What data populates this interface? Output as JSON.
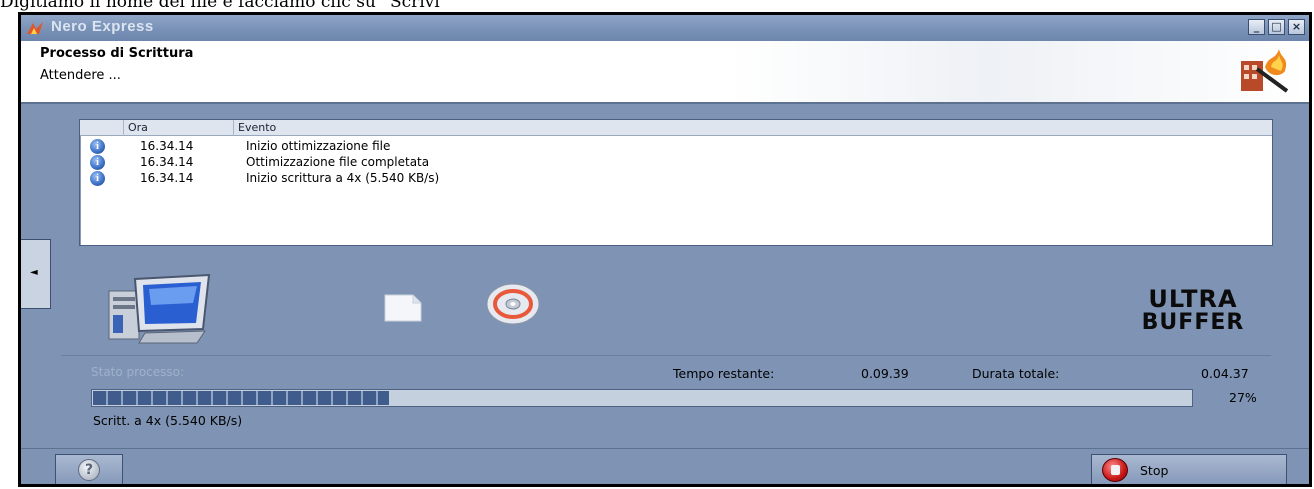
{
  "caption": "Digitiamo il nome del file e facciamo clic su “Scrivi”",
  "window": {
    "title": "Nero Express",
    "controls": {
      "minimize": "_",
      "maximize": "□",
      "close": "×"
    }
  },
  "header": {
    "title": "Processo di Scrittura",
    "subtitle": "Attendere ..."
  },
  "log": {
    "columns": {
      "time": "Ora",
      "event": "Evento"
    },
    "rows": [
      {
        "icon": "info-icon",
        "time": "16.34.14",
        "event": "Inizio ottimizzazione file"
      },
      {
        "icon": "info-icon",
        "time": "16.34.14",
        "event": "Ottimizzazione file completata"
      },
      {
        "icon": "info-icon",
        "time": "16.34.14",
        "event": "Inizio scrittura a 4x (5.540 KB/s)"
      }
    ]
  },
  "side_tab": {
    "arrow": "◄"
  },
  "ultrabuffer_logo": "ULTRA BUFFER",
  "status": {
    "label": "Stato processo:",
    "remaining_label": "Tempo restante:",
    "remaining_value": "0.09.39",
    "total_label": "Durata totale:",
    "total_value": "0.04.37",
    "progress": 27,
    "progress_text": "27%",
    "speed_text": "Scritt. a 4x (5.540 KB/s)"
  },
  "buttons": {
    "help": "?",
    "stop": "Stop"
  }
}
